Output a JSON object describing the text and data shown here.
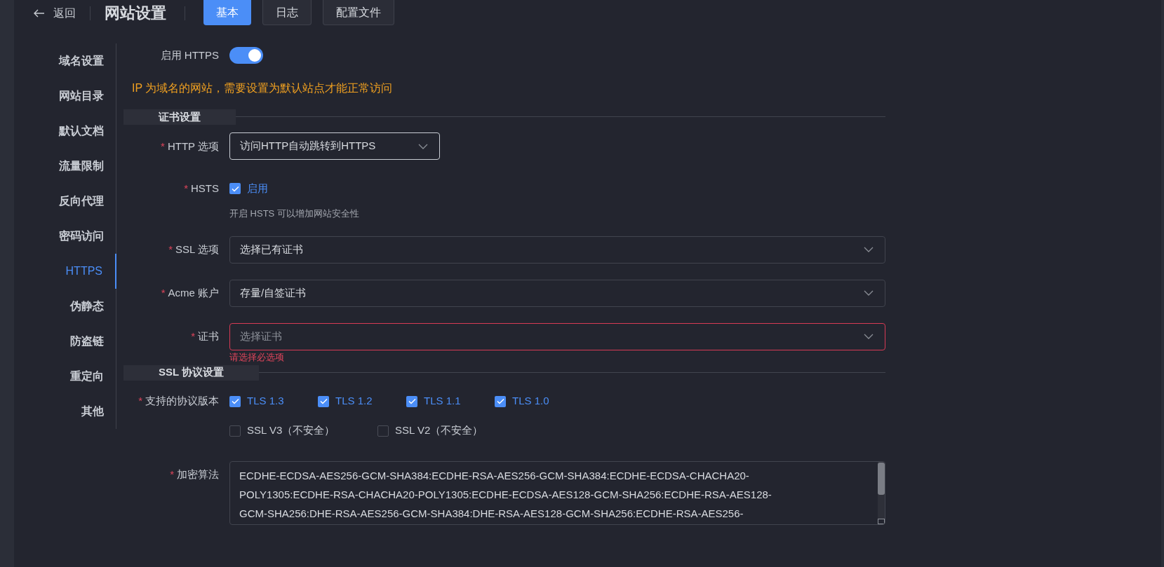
{
  "header": {
    "back": "返回",
    "title": "网站设置",
    "tabs": [
      {
        "label": "基本",
        "selected": true
      },
      {
        "label": "日志",
        "selected": false
      },
      {
        "label": "配置文件",
        "selected": false
      }
    ]
  },
  "sidebar": {
    "items": [
      {
        "label": "域名设置",
        "selected": false
      },
      {
        "label": "网站目录",
        "selected": false
      },
      {
        "label": "默认文档",
        "selected": false
      },
      {
        "label": "流量限制",
        "selected": false
      },
      {
        "label": "反向代理",
        "selected": false
      },
      {
        "label": "密码访问",
        "selected": false
      },
      {
        "label": "HTTPS",
        "selected": true
      },
      {
        "label": "伪静态",
        "selected": false
      },
      {
        "label": "防盗链",
        "selected": false
      },
      {
        "label": "重定向",
        "selected": false
      },
      {
        "label": "其他",
        "selected": false
      }
    ]
  },
  "https_toggle": {
    "label": "启用 HTTPS",
    "on": true
  },
  "warning": "IP 为域名的网站，需要设置为默认站点才能正常访问",
  "sections": [
    {
      "title": "证书设置",
      "fields": [
        {
          "kind": "select",
          "label": "HTTP 选项",
          "required_mark": "*",
          "value": "访问HTTP自动跳转到HTTPS",
          "compact": true
        },
        {
          "kind": "checkbox",
          "label": "HSTS",
          "required_mark": "*",
          "option": "启用",
          "checked": true,
          "hint": "开启 HSTS 可以增加网站安全性"
        },
        {
          "kind": "select",
          "label": "SSL 选项",
          "required_mark": "*",
          "value": "选择已有证书"
        },
        {
          "kind": "select",
          "label": "Acme 账户",
          "required_mark": "*",
          "value": "存量/自签证书"
        },
        {
          "kind": "select",
          "label": "证书",
          "required_mark": "*",
          "placeholder": "选择证书",
          "error": "请选择必选项"
        }
      ]
    },
    {
      "title": "SSL 协议设置",
      "fields": [
        {
          "kind": "checkgroup",
          "label": "支持的协议版本",
          "required_mark": "*",
          "options": [
            {
              "label": "TLS 1.3",
              "checked": true
            },
            {
              "label": "TLS 1.2",
              "checked": true
            },
            {
              "label": "TLS 1.1",
              "checked": true
            },
            {
              "label": "TLS 1.0",
              "checked": true
            },
            {
              "label": "SSL V3（不安全）",
              "checked": false
            },
            {
              "label": "SSL V2（不安全）",
              "checked": false
            }
          ]
        },
        {
          "kind": "textarea",
          "label": "加密算法",
          "required_mark": "*",
          "value": "ECDHE-ECDSA-AES256-GCM-SHA384:ECDHE-RSA-AES256-GCM-SHA384:ECDHE-ECDSA-CHACHA20-\nPOLY1305:ECDHE-RSA-CHACHA20-POLY1305:ECDHE-ECDSA-AES128-GCM-SHA256:ECDHE-RSA-AES128-\nGCM-SHA256:DHE-RSA-AES256-GCM-SHA384:DHE-RSA-AES128-GCM-SHA256:ECDHE-RSA-AES256-"
        }
      ]
    }
  ]
}
